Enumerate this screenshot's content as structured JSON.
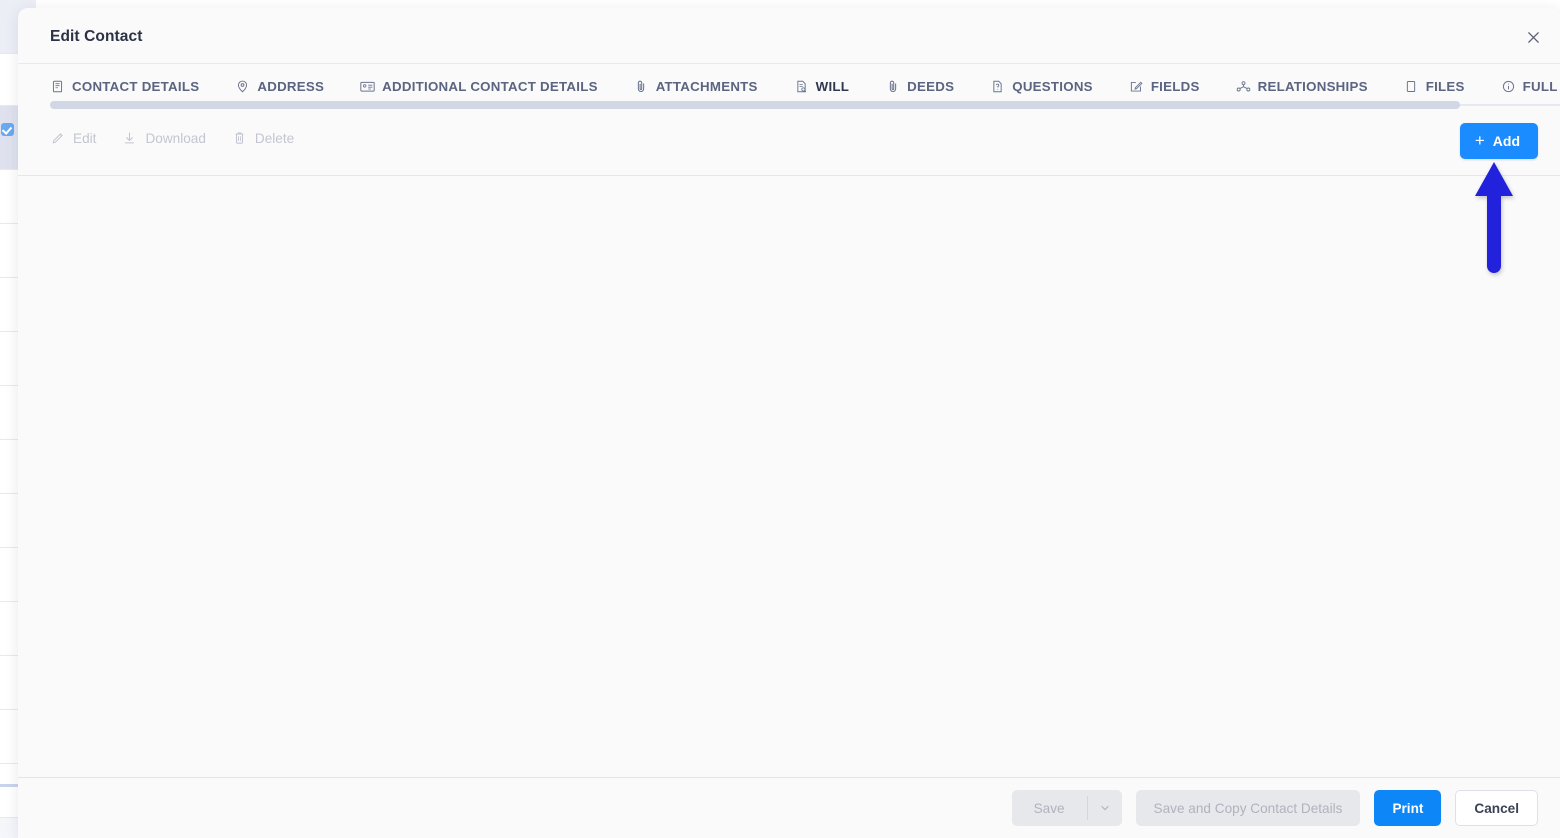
{
  "window": {
    "title": "Edit Contact",
    "close_icon": "close-icon"
  },
  "tabs": [
    {
      "label": "CONTACT DETAILS",
      "icon": "contact-card-icon",
      "active": false
    },
    {
      "label": "ADDRESS",
      "icon": "map-pin-icon",
      "active": false
    },
    {
      "label": "ADDITIONAL CONTACT DETAILS",
      "icon": "id-card-icon",
      "active": false
    },
    {
      "label": "ATTACHMENTS",
      "icon": "paperclip-icon",
      "active": false
    },
    {
      "label": "WILL",
      "icon": "document-search-icon",
      "active": true
    },
    {
      "label": "DEEDS",
      "icon": "paperclip-icon",
      "active": false
    },
    {
      "label": "QUESTIONS",
      "icon": "question-document-icon",
      "active": false
    },
    {
      "label": "FIELDS",
      "icon": "edit-square-icon",
      "active": false
    },
    {
      "label": "RELATIONSHIPS",
      "icon": "people-network-icon",
      "active": false
    },
    {
      "label": "FILES",
      "icon": "file-icon",
      "active": false
    },
    {
      "label": "FULL INFORMATION",
      "icon": "info-circle-icon",
      "active": false
    }
  ],
  "toolbar": {
    "edit_label": "Edit",
    "download_label": "Download",
    "delete_label": "Delete",
    "add_label": "Add",
    "add_icon": "plus-icon",
    "add_color": "#1a8cff"
  },
  "footer": {
    "save_label": "Save",
    "save_menu_icon": "chevron-down-icon",
    "save_copy_label": "Save and Copy Contact Details",
    "print_label": "Print",
    "cancel_label": "Cancel",
    "primary_color": "#0d86f8"
  },
  "annotation": {
    "type": "arrow-up",
    "color": "#2222dd",
    "points_to": "Add"
  }
}
